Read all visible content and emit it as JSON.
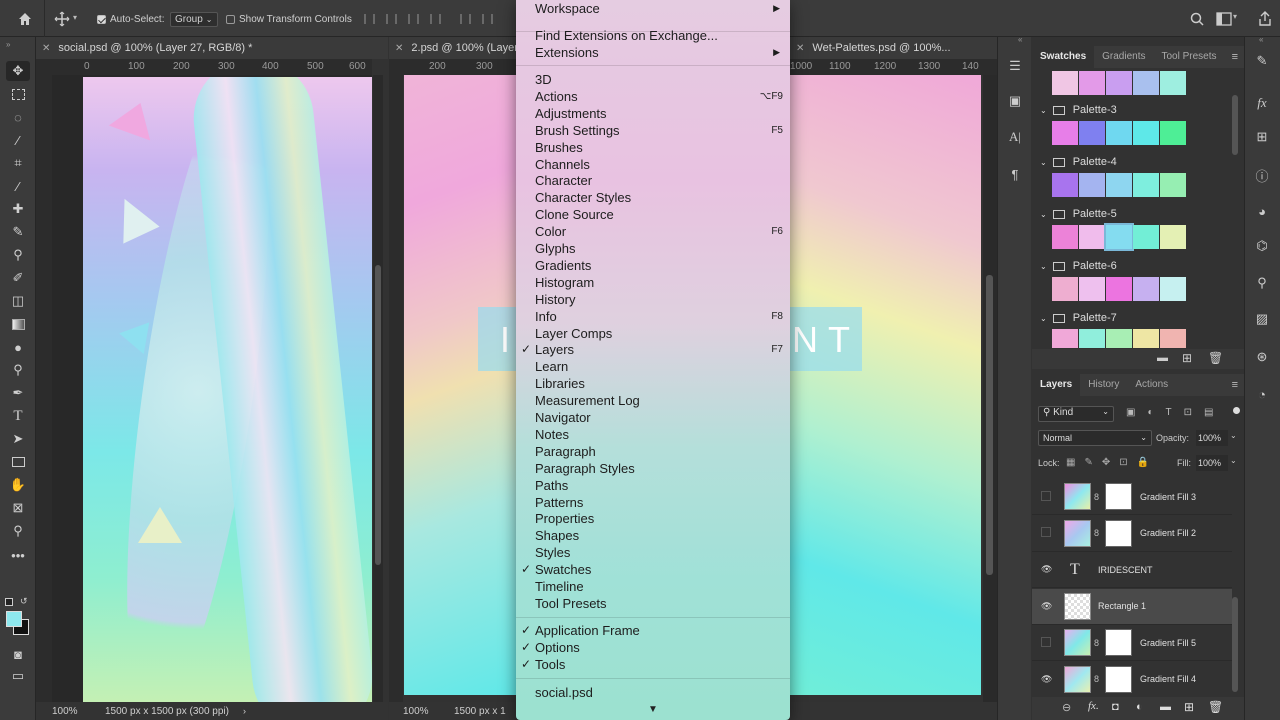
{
  "options_bar": {
    "auto_select_label": "Auto-Select:",
    "auto_select_value": "Group",
    "transform_controls_label": "Show Transform Controls"
  },
  "documents": [
    {
      "tab": "social.psd @ 100% (Layer 27, RGB/8) *",
      "zoom": "100%",
      "info": "1500 px x 1500 px (300 ppi)"
    },
    {
      "tab": "2.psd @ 100% (Layer",
      "zoom": "100%",
      "info": "1500 px x 1"
    },
    {
      "tab": "Wet-Palettes.psd @ 100%..."
    }
  ],
  "rulers": {
    "doc1": [
      "0",
      "100",
      "200",
      "300",
      "400",
      "500",
      "600"
    ],
    "doc2": [
      "200",
      "300"
    ],
    "doc3": [
      "1000",
      "1100",
      "1200",
      "1300",
      "140"
    ]
  },
  "canvas_text": {
    "left": "I",
    "right": "NT"
  },
  "menu": {
    "top": [
      {
        "label": "Workspace",
        "submenu": true
      },
      {
        "label": "Find Extensions on Exchange..."
      },
      {
        "label": "Extensions",
        "submenu": true
      }
    ],
    "panels": [
      {
        "label": "3D"
      },
      {
        "label": "Actions",
        "shortcut": "⌥F9"
      },
      {
        "label": "Adjustments"
      },
      {
        "label": "Brush Settings",
        "shortcut": "F5"
      },
      {
        "label": "Brushes"
      },
      {
        "label": "Channels"
      },
      {
        "label": "Character"
      },
      {
        "label": "Character Styles"
      },
      {
        "label": "Clone Source"
      },
      {
        "label": "Color",
        "shortcut": "F6"
      },
      {
        "label": "Glyphs"
      },
      {
        "label": "Gradients"
      },
      {
        "label": "Histogram"
      },
      {
        "label": "History"
      },
      {
        "label": "Info",
        "shortcut": "F8"
      },
      {
        "label": "Layer Comps"
      },
      {
        "label": "Layers",
        "shortcut": "F7",
        "checked": true
      },
      {
        "label": "Learn"
      },
      {
        "label": "Libraries"
      },
      {
        "label": "Measurement Log"
      },
      {
        "label": "Navigator"
      },
      {
        "label": "Notes"
      },
      {
        "label": "Paragraph"
      },
      {
        "label": "Paragraph Styles"
      },
      {
        "label": "Paths"
      },
      {
        "label": "Patterns"
      },
      {
        "label": "Properties"
      },
      {
        "label": "Shapes"
      },
      {
        "label": "Styles"
      },
      {
        "label": "Swatches",
        "checked": true
      },
      {
        "label": "Timeline"
      },
      {
        "label": "Tool Presets"
      }
    ],
    "app": [
      {
        "label": "Application Frame",
        "checked": true
      },
      {
        "label": "Options",
        "checked": true
      },
      {
        "label": "Tools",
        "checked": true
      }
    ],
    "docs": [
      {
        "label": "social.psd"
      }
    ],
    "more_arrow": "▼"
  },
  "swatches_panel": {
    "tabs": [
      "Swatches",
      "Gradients",
      "Tool Presets"
    ],
    "groups": [
      {
        "name": "",
        "colors": [
          "#f0c6e4",
          "#e39ae8",
          "#c99ef0",
          "#a9c0ee",
          "#9eeee0"
        ]
      },
      {
        "name": "Palette-3",
        "colors": [
          "#e77ee8",
          "#7f80f0",
          "#6fd8f0",
          "#5ee8e8",
          "#4eee96"
        ]
      },
      {
        "name": "Palette-4",
        "colors": [
          "#a874ee",
          "#a4b4f0",
          "#8ed6f0",
          "#7eeede",
          "#96eeb2"
        ]
      },
      {
        "name": "Palette-5",
        "colors": [
          "#ec82d8",
          "#f0bcec",
          "#84dcf0",
          "#72eed6",
          "#e4f0b4"
        ]
      },
      {
        "name": "Palette-6",
        "colors": [
          "#eeaed0",
          "#eec0ee",
          "#ec74e0",
          "#c6b0f0",
          "#c6f0f0"
        ]
      },
      {
        "name": "Palette-7",
        "colors": [
          "#f0a8d8",
          "#90eedc",
          "#a8eeb4",
          "#eee6a4",
          "#f0b4b0"
        ]
      }
    ]
  },
  "layers_panel": {
    "tabs": [
      "Layers",
      "History",
      "Actions"
    ],
    "filter": "Kind",
    "blend_mode": "Normal",
    "opacity_label": "Opacity:",
    "opacity_value": "100%",
    "lock_label": "Lock:",
    "fill_label": "Fill:",
    "fill_value": "100%",
    "layers": [
      {
        "name": "Gradient Fill 3",
        "visible": false
      },
      {
        "name": "Gradient Fill 2",
        "visible": false
      },
      {
        "name": "IRIDESCENT",
        "visible": true
      },
      {
        "name": "Rectangle 1",
        "visible": true
      },
      {
        "name": "Gradient Fill 5",
        "visible": false
      },
      {
        "name": "Gradient Fill 4",
        "visible": true
      }
    ],
    "footer_icons": [
      "link-icon",
      "fx-icon",
      "mask-icon",
      "adjustment-icon",
      "folder-icon",
      "new-layer-icon",
      "trash-icon"
    ]
  }
}
